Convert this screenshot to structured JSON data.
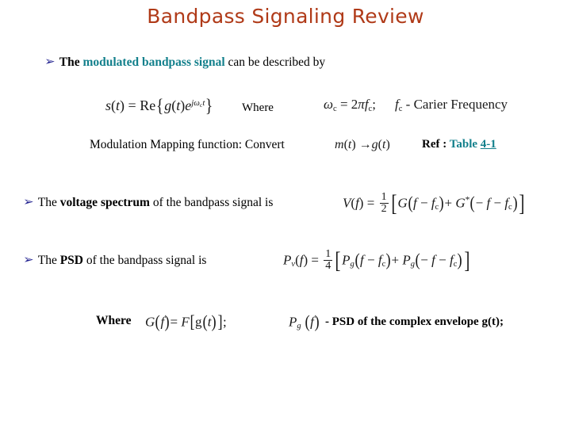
{
  "slide": {
    "title": "Bandpass Signaling Review",
    "background_color": "#ffffff",
    "title_color": "#b03a18",
    "accent_teal": "#13808c",
    "bullet_color": "#1f1f8f"
  },
  "bullets": [
    {
      "glyph": "➢",
      "prefix": "The ",
      "highlight": "modulated bandpass signal",
      "suffix": " can be described by"
    },
    {
      "glyph": "➢",
      "prefix": "The ",
      "highlight": "voltage spectrum",
      "suffix": " of the bandpass signal is"
    },
    {
      "glyph": "➢",
      "prefix": "The ",
      "highlight": "PSD",
      "suffix": " of the bandpass signal is"
    }
  ],
  "equations": {
    "signal": {
      "lhs": "s(t)",
      "eq": "=",
      "rhs": "Re{g(t)e^{jω_c t}}",
      "plain": "s(t) = Re{g(t)e^{jωct}}"
    },
    "carrier": {
      "plain": "ωc = 2πfc;",
      "note": "fc - Carier Frequency"
    },
    "voltage_spectrum": {
      "plain": "V(f) = 1/2 [ G(f - fc) + G*(-f - fc) ]"
    },
    "psd": {
      "plain": "Pv(f) = 1/4 [ Pg(f - fc) + Pg(-f - fc) ]"
    },
    "fourier": {
      "plain": "G(f) = F[g(t)];"
    },
    "pg_note": {
      "symbol": "Pg(f)",
      "text": "- PSD of the complex envelope g(t);"
    }
  },
  "labels": {
    "where_1": "Where",
    "where_2": "Where",
    "carrier_frequency": "- Carier Frequency",
    "mapping": "Modulation Mapping function: Convert",
    "mapping_math": "m(t) →g(t)",
    "ref_prefix": "Ref : ",
    "ref_table_word": "Table ",
    "ref_table_number": "4-1"
  }
}
